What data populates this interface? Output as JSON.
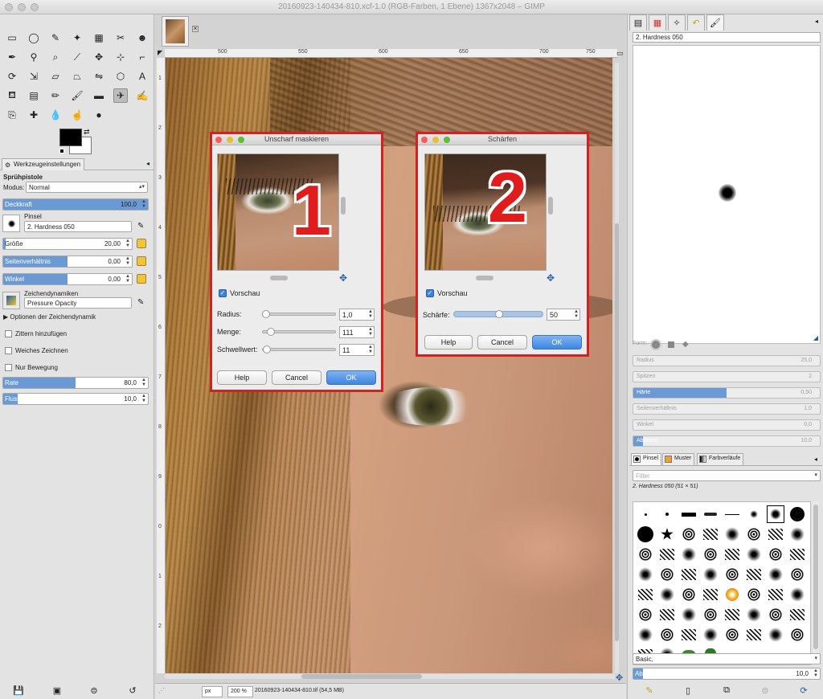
{
  "window": {
    "title": "20160923-140434-810.xcf-1.0 (RGB-Farben, 1 Ebene) 1367x2048 – GIMP"
  },
  "toolbox": {
    "tools": [
      {
        "name": "rect-select-tool",
        "icon": "▭"
      },
      {
        "name": "ellipse-select-tool",
        "icon": "◯"
      },
      {
        "name": "lasso-tool",
        "icon": "✎"
      },
      {
        "name": "fuzzy-select-tool",
        "icon": "✦"
      },
      {
        "name": "color-select-tool",
        "icon": "▦"
      },
      {
        "name": "scissors-tool",
        "icon": "✂"
      },
      {
        "name": "foreground-select-tool",
        "icon": "☻"
      },
      {
        "name": "paths-tool",
        "icon": "✒"
      },
      {
        "name": "color-picker-tool",
        "icon": "⚲"
      },
      {
        "name": "zoom-tool",
        "icon": "⌕"
      },
      {
        "name": "measure-tool",
        "icon": "⟋"
      },
      {
        "name": "move-tool",
        "icon": "✥"
      },
      {
        "name": "align-tool",
        "icon": "⊹"
      },
      {
        "name": "crop-tool",
        "icon": "⌐"
      },
      {
        "name": "rotate-tool",
        "icon": "⟳"
      },
      {
        "name": "scale-tool",
        "icon": "⇲"
      },
      {
        "name": "shear-tool",
        "icon": "▱"
      },
      {
        "name": "perspective-tool",
        "icon": "⏢"
      },
      {
        "name": "flip-tool",
        "icon": "⇋"
      },
      {
        "name": "cage-tool",
        "icon": "⬡"
      },
      {
        "name": "text-tool",
        "icon": "A"
      },
      {
        "name": "bucket-fill-tool",
        "icon": "⛾"
      },
      {
        "name": "blend-tool",
        "icon": "▤"
      },
      {
        "name": "pencil-tool",
        "icon": "✏"
      },
      {
        "name": "paintbrush-tool",
        "icon": "🖌"
      },
      {
        "name": "eraser-tool",
        "icon": "▬"
      },
      {
        "name": "airbrush-tool",
        "icon": "✈"
      },
      {
        "name": "ink-tool",
        "icon": "✍"
      },
      {
        "name": "clone-tool",
        "icon": "⎘"
      },
      {
        "name": "heal-tool",
        "icon": "✚"
      },
      {
        "name": "blur-tool",
        "icon": "💧"
      },
      {
        "name": "smudge-tool",
        "icon": "☝"
      },
      {
        "name": "dodge-burn-tool",
        "icon": "●"
      }
    ]
  },
  "tool_options": {
    "tab_label": "Werkzeugeinstellungen",
    "tool_name": "Sprühpistole",
    "mode_label": "Modus:",
    "mode_value": "Normal",
    "opacity": {
      "label": "Deckkraft",
      "value": "100,0",
      "fraction": 1.0
    },
    "brush_label": "Pinsel",
    "brush_value": "2. Hardness 050",
    "size": {
      "label": "Größe",
      "value": "20,00",
      "fraction": 0.02
    },
    "aspect": {
      "label": "Seitenverhältnis",
      "value": "0,00",
      "fraction": 0.5
    },
    "angle": {
      "label": "Winkel",
      "value": "0,00",
      "fraction": 0.5
    },
    "dynamics_label": "Zeichendynamiken",
    "dynamics_value": "Pressure Opacity",
    "dynamics_options": "Optionen der Zeichendynamik",
    "jitter": "Zittern hinzufügen",
    "smooth": "Weiches Zeichnen",
    "incremental": "Nur Bewegung",
    "rate": {
      "label": "Rate",
      "value": "80,0",
      "fraction": 0.5
    },
    "flow": {
      "label": "Fluss",
      "value": "10,0",
      "fraction": 0.1
    }
  },
  "canvas": {
    "ruler_ticks": [
      "500",
      "550",
      "600",
      "650",
      "700",
      "750"
    ],
    "ruler_v_ticks": [
      "1",
      "2",
      "3",
      "4",
      "5",
      "6",
      "7",
      "8",
      "9",
      "0",
      "1",
      "2"
    ],
    "status": {
      "unit": "px",
      "zoom": "200 %",
      "file": "20160923-140434-810.tif (54,5 MB)"
    }
  },
  "dialog1": {
    "title": "Unscharf maskieren",
    "badge": "1",
    "preview_label": "Vorschau",
    "radius_label": "Radius:",
    "radius_value": "1,0",
    "radius_fraction": 0.02,
    "amount_label": "Menge:",
    "amount_value": "111",
    "amount_fraction": 0.1,
    "threshold_label": "Schwellwert:",
    "threshold_value": "11",
    "threshold_fraction": 0.04,
    "help": "Help",
    "cancel": "Cancel",
    "ok": "OK"
  },
  "dialog2": {
    "title": "Schärfen",
    "badge": "2",
    "preview_label": "Vorschau",
    "sharpness_label": "Schärfe:",
    "sharpness_value": "50",
    "sharpness_fraction": 0.5,
    "help": "Help",
    "cancel": "Cancel",
    "ok": "OK"
  },
  "dock": {
    "brush_name": "2. Hardness 050",
    "form_label": "Form:",
    "params": [
      {
        "label": "Radius",
        "value": "25,0",
        "fraction": 0.0
      },
      {
        "label": "Spitzen",
        "value": "2",
        "fraction": 0.0
      },
      {
        "label": "Härte",
        "value": "0,50",
        "fraction": 0.5
      },
      {
        "label": "Seitenverhältnis",
        "value": "1,0",
        "fraction": 0.0
      },
      {
        "label": "Winkel",
        "value": "0,0",
        "fraction": 0.0
      },
      {
        "label": "Abstand",
        "value": "10,0",
        "fraction": 0.05
      }
    ],
    "brush_tabs": [
      "Pinsel",
      "Muster",
      "Farbverläufe"
    ],
    "filter_placeholder": "Filter",
    "selected_brush": "2. Hardness 050 (51 × 51)",
    "tag_value": "Basic,",
    "spacing": {
      "label": "Abstand",
      "value": "10,0",
      "fraction": 0.05
    }
  }
}
